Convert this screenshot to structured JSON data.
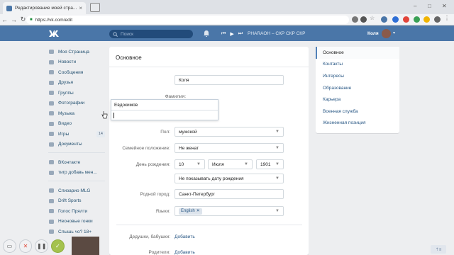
{
  "browser": {
    "tab_title": "Редактирование моей стра...",
    "url": "https://vk.com/edit"
  },
  "header": {
    "search_placeholder": "Поиск",
    "track": "PHARAOH – СКР СКР СКР",
    "user_name": "Коля"
  },
  "left_nav": {
    "items": [
      {
        "label": "Моя Страница"
      },
      {
        "label": "Новости"
      },
      {
        "label": "Сообщения"
      },
      {
        "label": "Друзья"
      },
      {
        "label": "Группы"
      },
      {
        "label": "Фотографии"
      },
      {
        "label": "Музыка"
      },
      {
        "label": "Видео"
      },
      {
        "label": "Игры",
        "count": "14"
      },
      {
        "label": "Документы"
      }
    ],
    "items2": [
      {
        "label": "ВКонтакте"
      },
      {
        "label": "тигр добавь мен..."
      }
    ],
    "items3": [
      {
        "label": "Слизарио MLG"
      },
      {
        "label": "Drift Sports"
      },
      {
        "label": "Голос Прялти"
      },
      {
        "label": "Неоновые гонки"
      },
      {
        "label": "Слышь чо? 18+"
      }
    ]
  },
  "main": {
    "title": "Основное",
    "first_name_label": "Имя:",
    "first_name": "Коля",
    "last_name_label": "Фамилия:",
    "autocomplete_option": "Евдокимов",
    "gender_label": "Пол:",
    "gender": "мужской",
    "marital_label": "Семейное положение:",
    "marital": "Не женат",
    "birthday_label": "День рождения:",
    "bday_day": "10",
    "bday_month": "Июля",
    "bday_year": "1901",
    "bday_visibility": "Не показывать дату рождения",
    "hometown_label": "Родной город:",
    "hometown": "Санкт-Петербург",
    "languages_label": "Языки:",
    "language_chip": "English",
    "grandparents_label": "Дедушки, бабушки:",
    "parents_label": "Родители:",
    "add_link": "Добавить"
  },
  "right_nav": {
    "items": [
      {
        "label": "Основное",
        "active": true
      },
      {
        "label": "Контакты"
      },
      {
        "label": "Интересы"
      },
      {
        "label": "Образование"
      },
      {
        "label": "Карьера"
      },
      {
        "label": "Военная служба"
      },
      {
        "label": "Жизненная позиция"
      }
    ]
  },
  "colors": {
    "accent": "#4a76a8",
    "link": "#2a5885",
    "background": "#edeef0"
  }
}
